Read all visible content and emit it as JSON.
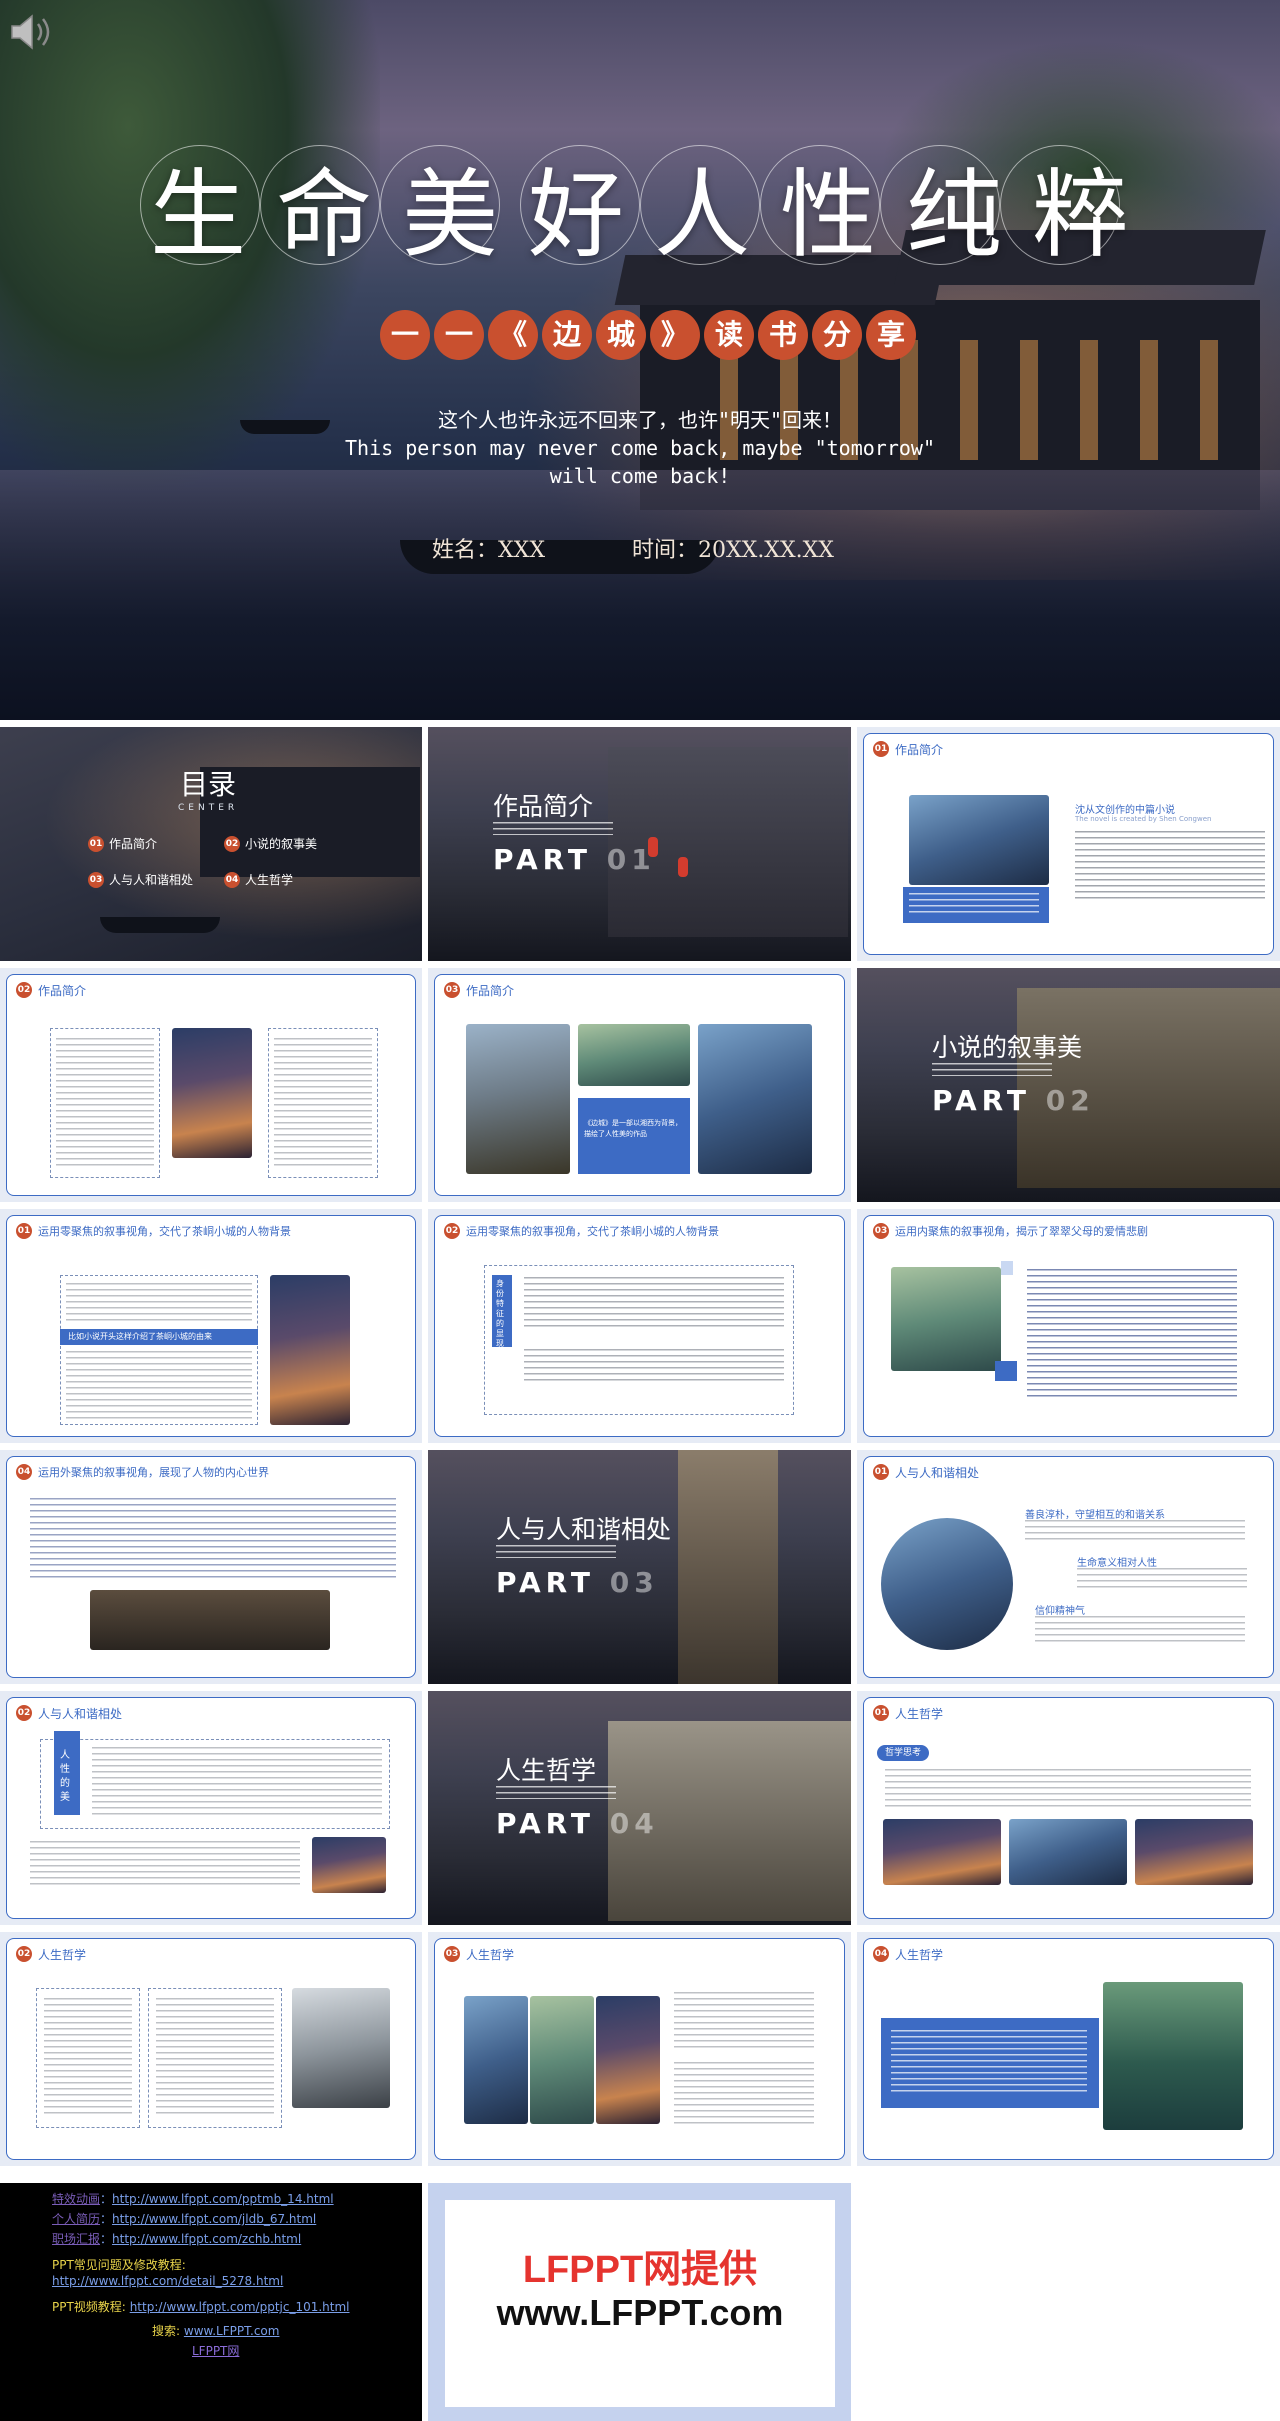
{
  "hero": {
    "title": "生命美好人性纯粹",
    "subtitle_chars": [
      "一",
      "一",
      "《",
      "边",
      "城",
      "》",
      "读",
      "书",
      "分",
      "享"
    ],
    "quote_cn": "这个人也许永远不回来了，也许\"明天\"回来！",
    "quote_en_1": "This person may never come back, maybe \"tomorrow\"",
    "quote_en_2": "will come back!",
    "name_label": "姓名：XXX",
    "time_label": "时间：20XX.XX.XX"
  },
  "toc": {
    "title": "目录",
    "en": "CENTER",
    "items": [
      {
        "num": "01",
        "label": "作品简介"
      },
      {
        "num": "02",
        "label": "小说的叙事美"
      },
      {
        "num": "03",
        "label": "人与人和谐相处"
      },
      {
        "num": "04",
        "label": "人生哲学"
      }
    ]
  },
  "sections": [
    {
      "title": "作品简介",
      "part": "PART",
      "num": "01"
    },
    {
      "title": "小说的叙事美",
      "part": "PART",
      "num": "02"
    },
    {
      "title": "人与人和谐相处",
      "part": "PART",
      "num": "03"
    },
    {
      "title": "人生哲学",
      "part": "PART",
      "num": "04"
    }
  ],
  "slides": {
    "s3": {
      "num": "01",
      "head": "作品简介",
      "sub": "沈从文创作的中篇小说",
      "sub_en": "The novel is created by Shen Congwen"
    },
    "s4": {
      "num": "02",
      "head": "作品简介"
    },
    "s5": {
      "num": "03",
      "head": "作品简介",
      "quote": "《边城》是一部以湘西为背景，描绘了人性美的作品"
    },
    "s7": {
      "num": "01",
      "head": "运用零聚焦的叙事视角，交代了茶峒小城的人物背景",
      "band": "比如小说开头这样介绍了茶峒小城的由来"
    },
    "s8": {
      "num": "02",
      "head": "运用零聚焦的叙事视角，交代了茶峒小城的人物背景",
      "vertical": "身份特征的显现"
    },
    "s9": {
      "num": "03",
      "head": "运用内聚焦的叙事视角，揭示了翠翠父母的爱情悲剧"
    },
    "s10": {
      "num": "04",
      "head": "运用外聚焦的叙事视角，展现了人物的内心世界"
    },
    "s12": {
      "num": "01",
      "head": "人与人和谐相处",
      "l1": "善良淳朴，守望相互的和谐关系",
      "l2": "生命意义相对人性",
      "l3": "信仰精神气"
    },
    "s13": {
      "num": "02",
      "head": "人与人和谐相处",
      "vertical": "人性的美"
    },
    "s15": {
      "num": "01",
      "head": "人生哲学",
      "pill": "哲学思考"
    },
    "s16": {
      "num": "02",
      "head": "人生哲学"
    },
    "s17": {
      "num": "03",
      "head": "人生哲学"
    },
    "s18": {
      "num": "04",
      "head": "人生哲学"
    }
  },
  "links": [
    {
      "label": "特效动画",
      "url": "http://www.lfppt.com/pptmb_14.html"
    },
    {
      "label": "个人简历",
      "url": "http://www.lfppt.com/jldb_67.html"
    },
    {
      "label": "职场汇报",
      "url": "http://www.lfppt.com/zchb.html"
    },
    {
      "label": "PPT常见问题及修改教程:",
      "url": "http://www.lfppt.com/detail_5278.html"
    },
    {
      "label": "PPT视频教程:",
      "url": "http://www.lfppt.com/pptjc_101.html"
    }
  ],
  "search": {
    "label": "搜索:",
    "url": "www.LFPPT.com",
    "name": "LFPPT网"
  },
  "brand": {
    "line1": "LFPPT网提供",
    "line2": "www.LFPPT.com"
  },
  "colors": {
    "accent_blue": "#3d6bc4",
    "accent_red": "#c9502f",
    "brand_red": "#e5342f"
  }
}
